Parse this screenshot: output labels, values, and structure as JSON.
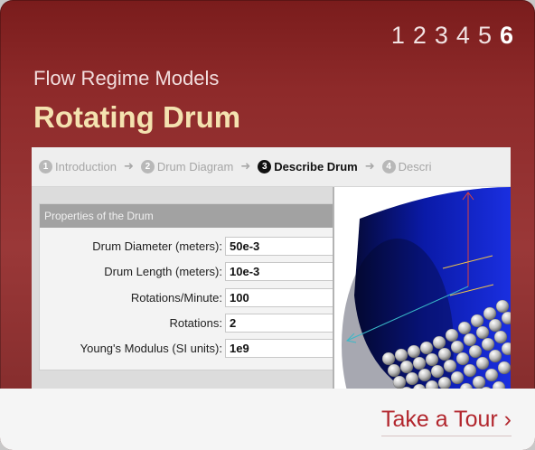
{
  "pager": {
    "pages": [
      "1",
      "2",
      "3",
      "4",
      "5",
      "6"
    ],
    "active_index": 5
  },
  "header": {
    "subtitle": "Flow Regime Models",
    "title": "Rotating Drum"
  },
  "wizard": {
    "steps": [
      {
        "num": "1",
        "label": "Introduction"
      },
      {
        "num": "2",
        "label": "Drum Diagram"
      },
      {
        "num": "3",
        "label": "Describe Drum"
      },
      {
        "num": "4",
        "label": "Descri"
      }
    ],
    "current_index": 2
  },
  "properties": {
    "header": "Properties of the Drum",
    "fields": [
      {
        "label": "Drum Diameter (meters):",
        "value": "50e-3"
      },
      {
        "label": "Drum Length (meters):",
        "value": "10e-3"
      },
      {
        "label": "Rotations/Minute:",
        "value": "100"
      },
      {
        "label": "Rotations:",
        "value": "2"
      },
      {
        "label": "Young's Modulus (SI units):",
        "value": "1e9"
      }
    ]
  },
  "footer": {
    "tour_label": "Take a Tour ›"
  },
  "colors": {
    "card": "#8e2a2a",
    "title": "#f4e2b0",
    "tour": "#b2262d",
    "drum": "#0a1aa8"
  }
}
